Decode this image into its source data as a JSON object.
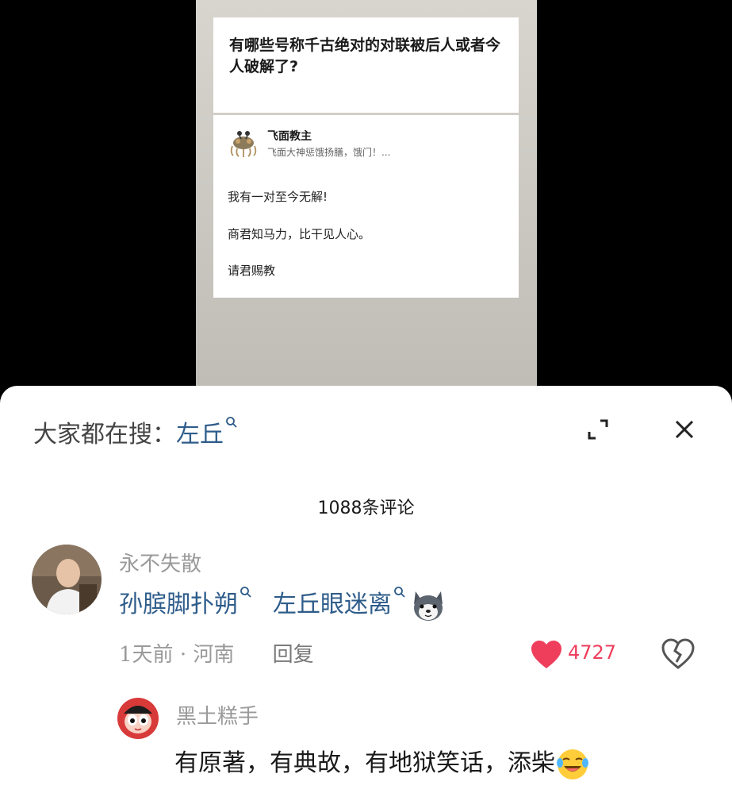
{
  "post": {
    "question": "有哪些号称千古绝对的对联被后人或者今人破解了?",
    "author": {
      "name": "飞面教主",
      "signature": "飞面大神惩饿扬膳，饿门！..."
    },
    "lines": [
      "我有一对至今无解!",
      "商君知马力，比干见人心。",
      "请君赐教"
    ]
  },
  "sheet": {
    "search_prefix": "大家都在搜：",
    "search_term": "左丘",
    "comment_count": "1088条评论"
  },
  "comment": {
    "username": "永不失散",
    "link1": "孙膑脚扑朔",
    "link2": "左丘眼迷离",
    "time": "1天前",
    "dot": "·",
    "location": "河南",
    "reply_label": "回复",
    "likes": "4727"
  },
  "reply": {
    "username": "黑土糕手",
    "text": "有原著，有典故，有地狱笑话，添柴"
  },
  "colors": {
    "link": "#2e5c8a",
    "like": "#ef3e5c",
    "muted": "#9a9a9a"
  },
  "icons": [
    "search-icon",
    "expand-icon",
    "close-icon",
    "heart-icon",
    "broken-heart-icon",
    "husky-emoji-icon",
    "laughing-emoji-icon"
  ]
}
